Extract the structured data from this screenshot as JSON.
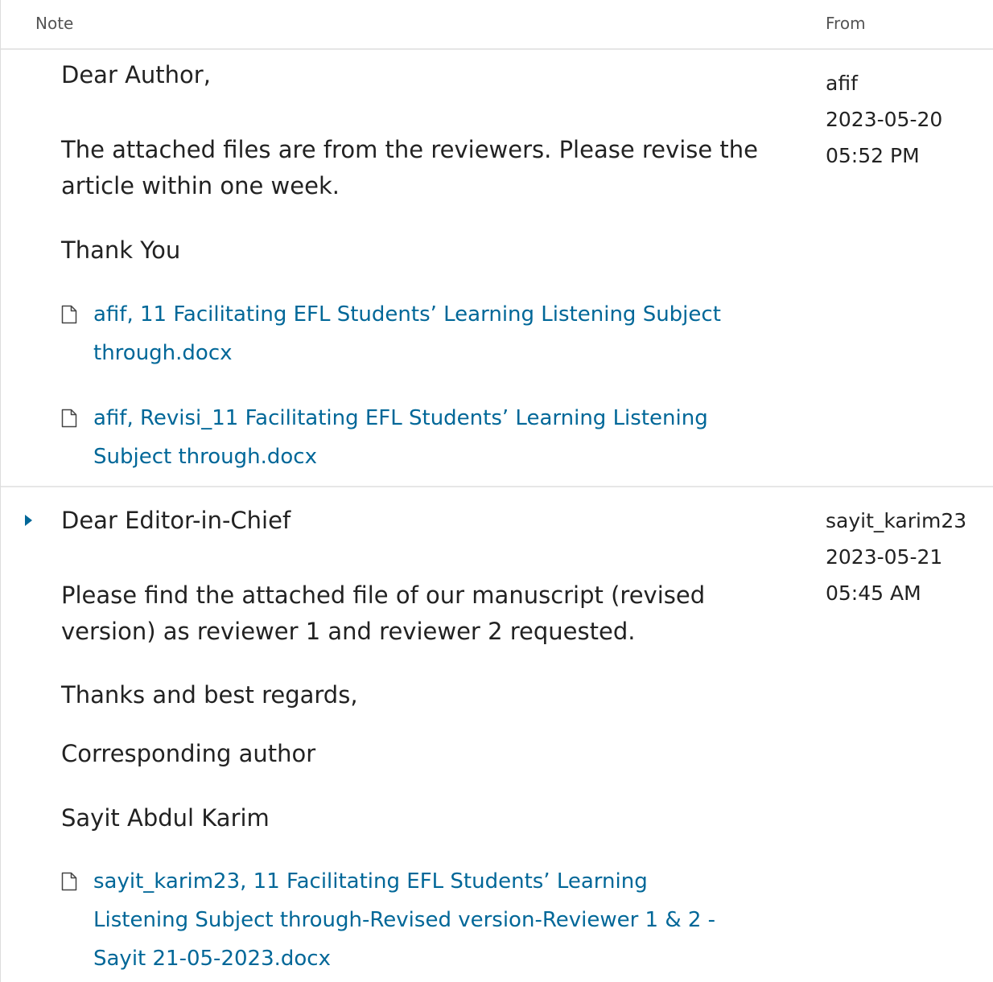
{
  "table": {
    "header_note": "Note",
    "header_from": "From"
  },
  "notes": [
    {
      "paragraphs": [
        "Dear Author,",
        "The attached files are from the reviewers. Please revise the article within one week.",
        "Thank You"
      ],
      "files": [
        "afif, 11 Facilitating EFL Students’ Learning Listening Subject through.docx",
        "afif, Revisi_11 Facilitating EFL Students’ Learning Listening Subject through.docx"
      ],
      "from": {
        "user": "afif",
        "date": "2023-05-20",
        "time": "05:52 PM"
      }
    },
    {
      "paragraphs": [
        "Dear Editor-in-Chief",
        "Please find the attached file of our manuscript (revised version) as reviewer 1 and reviewer 2 requested.",
        "Thanks and best regards,",
        "Corresponding author",
        "Sayit Abdul Karim"
      ],
      "files": [
        "sayit_karim23, 11 Facilitating EFL Students’ Learning Listening Subject through-Revised version-Reviewer 1 & 2 - Sayit 21-05-2023.docx"
      ],
      "from": {
        "user": "sayit_karim23",
        "date": "2023-05-21",
        "time": "05:45 AM"
      }
    }
  ],
  "icons": {
    "file": "file-icon",
    "expand": "expand-arrow-icon"
  },
  "colors": {
    "link": "#006798",
    "text": "#222222",
    "header_text": "#555555",
    "divider": "#e6e6e6"
  }
}
